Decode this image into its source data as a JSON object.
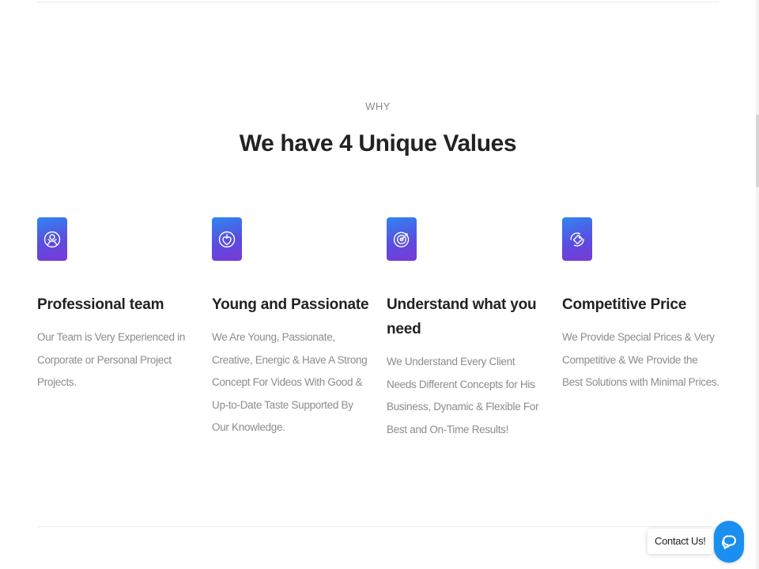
{
  "section": {
    "eyebrow": "WHY",
    "title": "We have 4 Unique Values"
  },
  "values": [
    {
      "icon": "team-icon",
      "title": "Professional team",
      "description": "Our Team is Very Experienced in Corporate or Personal Project Projects."
    },
    {
      "icon": "passion-icon",
      "title": "Young and Passionate",
      "description": "We Are Young, Passionate, Creative, Energic & Have A Strong Concept For Videos With Good & Up-to-Date Taste Supported By Our Knowledge."
    },
    {
      "icon": "target-icon",
      "title": "Understand what you need",
      "description": "We Understand Every Client Needs Different Concepts for His Business, Dynamic & Flexible For Best and On-Time Results!"
    },
    {
      "icon": "price-tag-icon",
      "title": "Competitive Price",
      "description": "We Provide Special Prices & Very Competitive & We Provide the Best Solutions with Minimal Prices."
    }
  ],
  "contact": {
    "label": "Contact Us!",
    "icon": "chat-icon"
  },
  "colors": {
    "icon_gradient_start": "#2f86f0",
    "icon_gradient_end": "#7a38d6",
    "chat_button": "#1a8ff0",
    "title_text": "#222222",
    "body_text": "#8c8c8c"
  }
}
